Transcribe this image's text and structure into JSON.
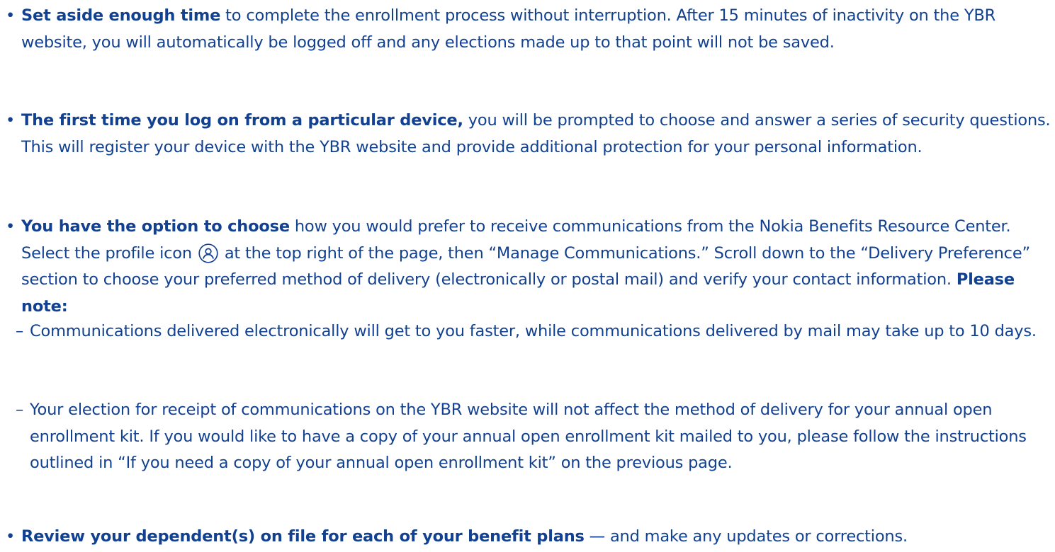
{
  "bullets": [
    {
      "lead": "Set aside enough time",
      "body": " to complete the enrollment process without  interruption. After 15 minutes of inactivity on the YBR website, you will automatically be logged off and any elections made up to that point will not be saved."
    },
    {
      "lead": "The first time you log on from a particular device,",
      "body": " you will be prompted to choose and answer a series of security questions. This will register your device with the YBR website and provide additional protection for your personal information."
    },
    {
      "lead": "You have the option to choose",
      "body_before_icon": " how you would prefer to receive communications from the Nokia Benefits Resource Center. Select the profile icon ",
      "icon": "profile-icon",
      "body_after_icon": " at the top right of the page, then “Manage Communications.” Scroll down to the “Delivery Preference” section to choose your preferred method of delivery (electronically or postal mail) and verify your contact information. ",
      "note": "Please note:",
      "subitems": [
        "Communications delivered electronically will get to you faster, while communications delivered by mail may take up to 10 days.",
        "Your election for receipt of communications on the YBR website will not affect the method of delivery for your annual open enrollment kit. If you would like to have a copy of your annual open enrollment kit mailed to you, please follow the instructions outlined in “If you need a copy of your annual open enrollment kit” on the previous page."
      ]
    },
    {
      "lead": "Review your dependent(s) on file for each of your benefit plans",
      "body": " — and make any updates or corrections."
    }
  ],
  "colors": {
    "text": "#124191",
    "background": "#ffffff"
  }
}
